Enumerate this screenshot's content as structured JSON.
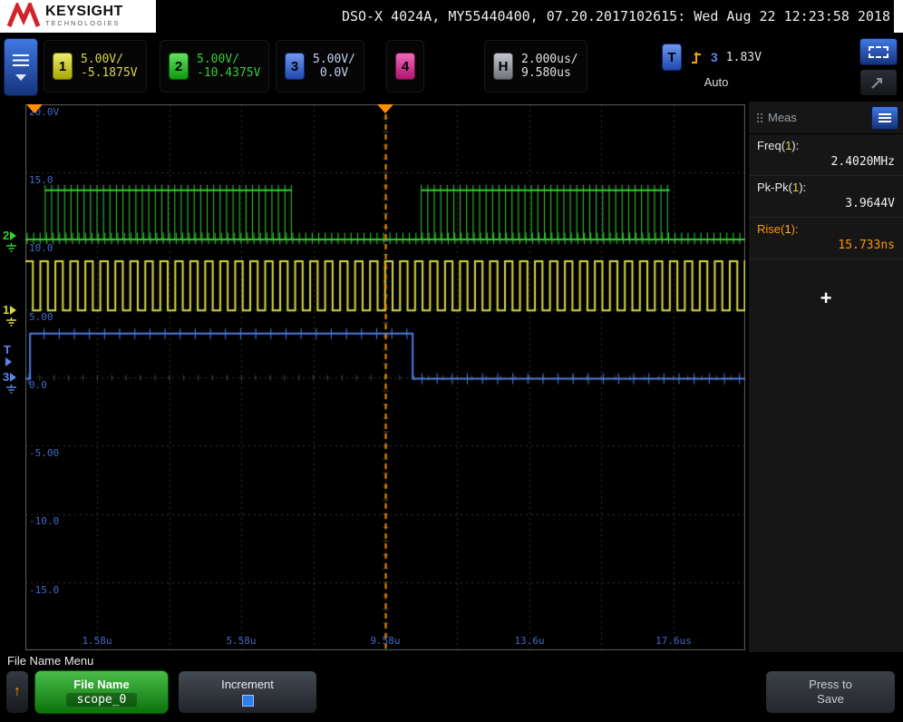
{
  "header": {
    "brand": "KEYSIGHT",
    "brand_sub": "TECHNOLOGIES",
    "session": "DSO-X 4024A, MY55440400, 07.20.2017102615: Wed Aug 22 12:23:58 2018"
  },
  "toolbar": {
    "channels": [
      {
        "num": "1",
        "scale": "5.00V/",
        "offset": "-5.1875V"
      },
      {
        "num": "2",
        "scale": "5.00V/",
        "offset": "-10.4375V"
      },
      {
        "num": "3",
        "scale": "5.00V/",
        "offset": "0.0V"
      },
      {
        "num": "4",
        "scale": "",
        "offset": ""
      }
    ],
    "horizontal": {
      "badge": "H",
      "scale": "2.000us/",
      "delay": "9.580us"
    },
    "trigger": {
      "badge": "T",
      "source": "3",
      "level": "1.83V",
      "mode": "Auto"
    }
  },
  "plot": {
    "y_labels": [
      "20.0V",
      "15.0",
      "10.0",
      "5.00",
      "0.0",
      "-5.00",
      "-10.0",
      "-15.0"
    ],
    "x_labels": [
      "1.58u",
      "5.58u",
      "9.58u",
      "13.6u",
      "17.6us"
    ]
  },
  "meas": {
    "title": "Meas",
    "items": [
      {
        "name": "Freq(",
        "chan": "1",
        "close": "):",
        "value": "2.4020MHz",
        "highlight": false
      },
      {
        "name": "Pk-Pk(",
        "chan": "1",
        "close": "):",
        "value": "3.9644V",
        "highlight": false
      },
      {
        "name": "Rise(",
        "chan": "1",
        "close": "):",
        "value": "15.733ns",
        "highlight": true
      }
    ],
    "add_button": "+"
  },
  "bottom": {
    "menu_title": "File Name Menu",
    "up_arrow": "↑",
    "file_name_label": "File Name",
    "file_name_value": "scope_0",
    "increment_label": "Increment",
    "save_line1": "Press to",
    "save_line2": "Save"
  },
  "colors": {
    "ch1": "#d9d943",
    "ch2": "#35cf35",
    "ch3": "#4d7de0",
    "ch4": "#e0319e",
    "accent_orange": "#ff8f00",
    "axis_blue": "#4169c8",
    "grid": "#343434",
    "grid_tick": "#4d4d4d",
    "border": "#5f5f5f"
  },
  "waveforms": {
    "time_span_us": 20,
    "y_range_v": 40,
    "trigger_time_frac": 0.5,
    "ch1": {
      "high_v": 8.5,
      "low_v": 4.9,
      "period_us": 0.4164
    },
    "ch2": {
      "base_v": 10.1,
      "burst_high_v": 13.7,
      "bursts_us": [
        [
          0.55,
          7.4
        ],
        [
          11.0,
          17.9
        ]
      ],
      "pulse_period_us": 0.18,
      "spike_v": 0.5
    },
    "ch3": {
      "high_v": 3.2,
      "low_v": -0.1,
      "rise_at_us": 0.13,
      "fall_at_us": 10.76,
      "spike_period_us": 0.42,
      "spike_v": 0.4
    }
  }
}
